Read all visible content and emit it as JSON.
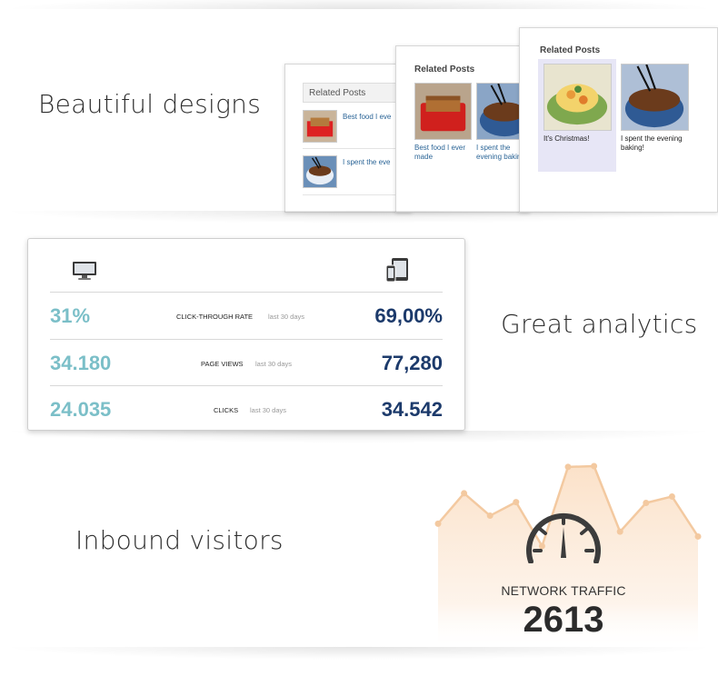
{
  "sections": {
    "designs": {
      "headline": "Beautiful designs"
    },
    "analytics": {
      "headline": "Great analytics"
    },
    "visitors": {
      "headline": "Inbound visitors"
    }
  },
  "widgets": {
    "list": {
      "title": "Related Posts",
      "posts": [
        {
          "title": "Best food I ever made",
          "visible_text": "Best food I eve"
        },
        {
          "title": "I spent the evening baking!",
          "visible_text": "I spent the eve"
        }
      ]
    },
    "grid": {
      "title": "Related Posts",
      "posts": [
        {
          "line1": "Best food I ever",
          "line2": "made"
        },
        {
          "line1": "I spent the",
          "line2": "evening bakin"
        }
      ]
    },
    "highlight": {
      "title": "Related Posts",
      "posts": [
        {
          "line1": "It's Christmas!",
          "line2": ""
        },
        {
          "line1": "I spent the evening",
          "line2": "baking!"
        }
      ]
    }
  },
  "analytics": {
    "left_device": "desktop-monitor-icon",
    "right_device": "mobile-tablet-icon",
    "rows": [
      {
        "metric": "CLICK-THROUGH RATE",
        "period": "last 30 days",
        "desktop": "31%",
        "mobile": "69,00%"
      },
      {
        "metric": "PAGE VIEWS",
        "period": "last 30 days",
        "desktop": "34.180",
        "mobile": "77,280"
      },
      {
        "metric": "CLICKS",
        "period": "last 30 days",
        "desktop": "24.035",
        "mobile": "34.542"
      }
    ],
    "colors": {
      "desktop": "#7bbfc8",
      "mobile": "#1c3a6b"
    }
  },
  "traffic": {
    "label": "NETWORK TRAFFIC",
    "value": "2613",
    "gauge_icon": "speedometer-icon",
    "line_color": "#f3c9a0",
    "relative_levels": [
      0.28,
      0.66,
      0.38,
      0.55,
      0.0,
      0.99,
      1.0,
      0.18,
      0.54,
      0.62,
      0.12
    ]
  }
}
